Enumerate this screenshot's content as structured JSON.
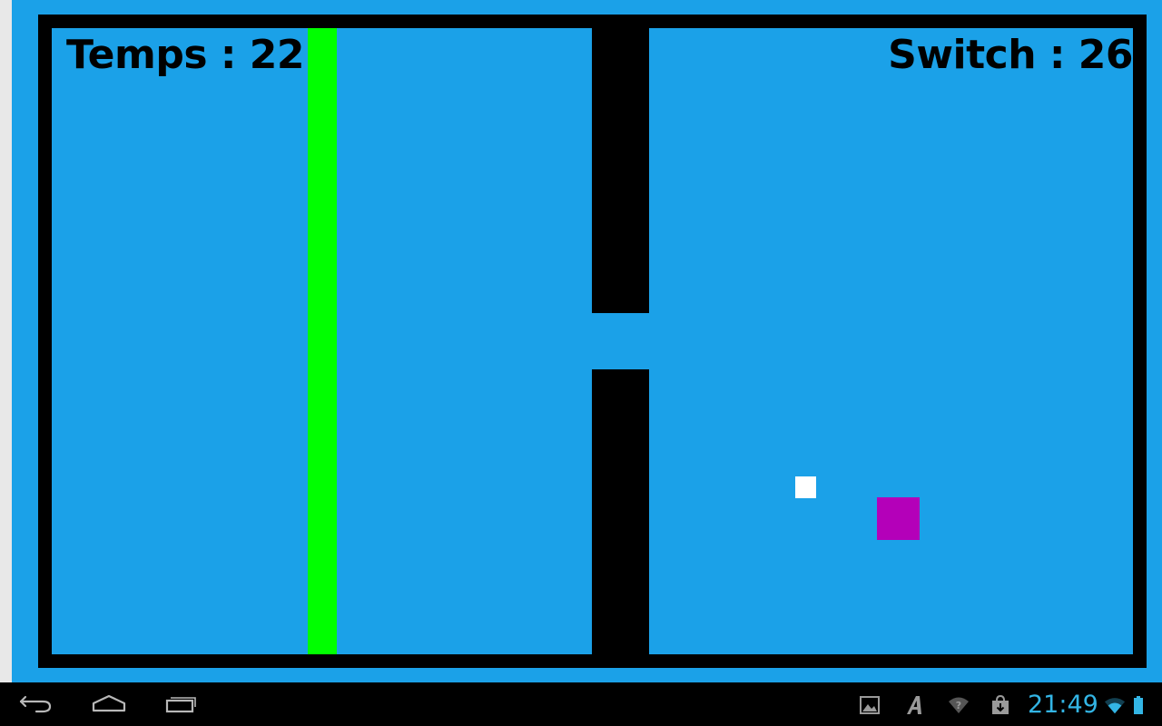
{
  "game": {
    "hud": {
      "temps_label": "Temps : 22",
      "switch_label": "Switch : 26"
    },
    "colors": {
      "background": "#1ba1e8",
      "border": "#000000",
      "goal_bar": "#00ff00",
      "wall": "#000000",
      "player": "#ffffff",
      "enemy": "#b400b9"
    }
  },
  "system_bar": {
    "clock": "21:49",
    "nav_buttons": [
      "back-icon",
      "home-icon",
      "recent-apps-icon"
    ],
    "status_icons": [
      "gallery-notification-icon",
      "font-app-notification-icon",
      "wifi-unknown-icon",
      "download-store-icon",
      "wifi-icon",
      "battery-icon"
    ],
    "accent_color": "#33b5e5"
  }
}
